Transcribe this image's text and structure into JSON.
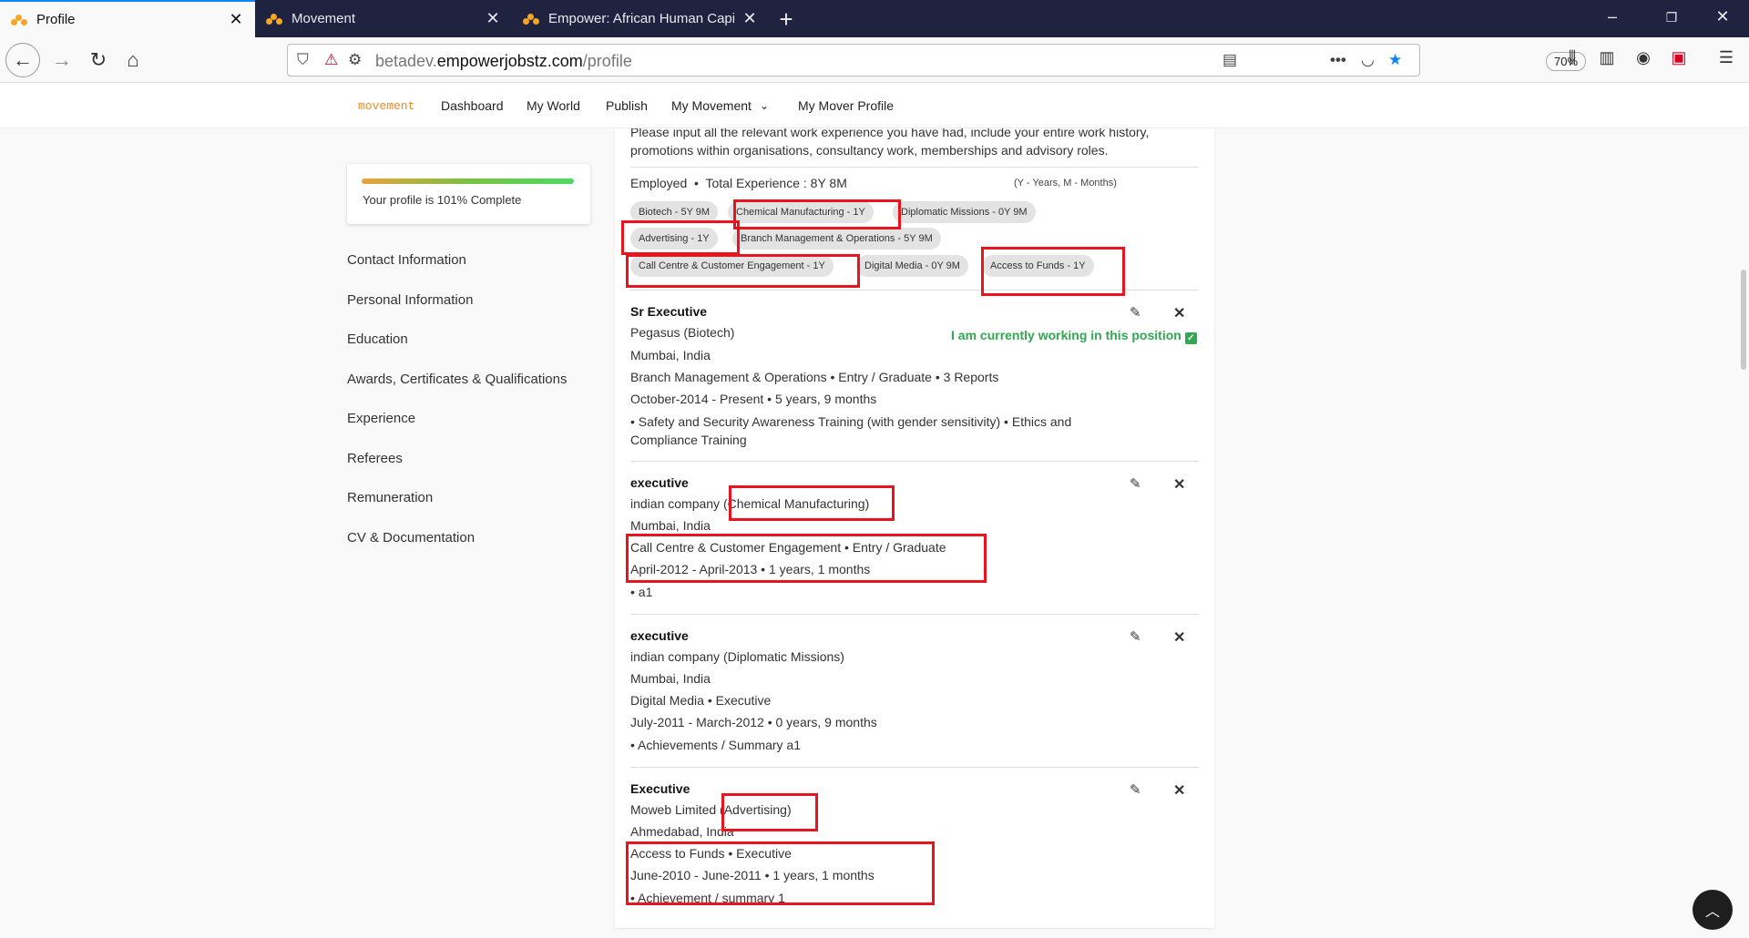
{
  "browser": {
    "tabs": [
      {
        "title": "Profile",
        "active": true
      },
      {
        "title": "Movement",
        "active": false
      },
      {
        "title": "Empower: African Human Capi",
        "active": false
      }
    ],
    "new_tab": "+",
    "url_domain_prefix": "betadev.",
    "url_domain": "empowerjobstz.com",
    "url_path": "/profile",
    "zoom": "70%"
  },
  "site": {
    "brand": "movement",
    "nav": [
      "Dashboard",
      "My World",
      "Publish",
      "My Movement",
      "My Mover Profile"
    ]
  },
  "profile": {
    "progress_text": "Your profile is 101% Complete",
    "progress_percent": 101
  },
  "sidebar": {
    "items": [
      "Contact Information",
      "Personal Information",
      "Education",
      "Awards, Certificates & Qualifications",
      "Experience",
      "Referees",
      "Remuneration",
      "CV & Documentation"
    ]
  },
  "experience": {
    "intro": "Please input all the relevant work experience you have had, include your entire work history, promotions within organisations, consultancy work, memberships and advisory roles.",
    "status": "Employed",
    "total": "Total Experience : 8Y 8M",
    "legend": "(Y - Years, M - Months)",
    "chips": [
      "Biotech - 5Y 9M",
      "Chemical Manufacturing - 1Y",
      "Diplomatic Missions - 0Y 9M",
      "Advertising - 1Y",
      "Branch Management & Operations - 5Y 9M",
      "Call Centre & Customer Engagement - 1Y",
      "Digital Media - 0Y 9M",
      "Access to Funds - 1Y"
    ],
    "entries": [
      {
        "title": "Sr Executive",
        "company": "Pegasus (Biotech)",
        "location": "Mumbai, India",
        "role_line": "Branch Management & Operations  •  Entry / Graduate  •  3 Reports",
        "period": "October-2014 - Present  •  5 years, 9 months",
        "notes": "•  Safety and Security Awareness Training (with gender sensitivity)  •  Ethics and Compliance Training",
        "current_label": "I am currently working in this position"
      },
      {
        "title": "executive",
        "company": "indian company",
        "industry": "(Chemical Manufacturing)",
        "location": "Mumbai, India",
        "role_line": "Call Centre & Customer Engagement  •  Entry / Graduate",
        "period": "April-2012 - April-2013  •  1 years, 1 months",
        "notes": "•  a1"
      },
      {
        "title": "executive",
        "company": "indian company (Diplomatic Missions)",
        "location": "Mumbai, India",
        "role_line": "Digital Media  •  Executive",
        "period": "July-2011 - March-2012  •  0 years, 9 months",
        "notes": "•  Achievements / Summary a1"
      },
      {
        "title": "Executive",
        "company": "Moweb Limited",
        "industry": "(Advertising)",
        "location": "Ahmedabad, India",
        "role_line": "Access to Funds  •  Executive",
        "period": "June-2010 - June-2011  •  1 years, 1 months",
        "notes": "•  Achievement / summary 1"
      }
    ]
  },
  "icons": {
    "edit": "pencil-icon",
    "delete": "close-icon",
    "back_to_top": "chevron-up-icon"
  }
}
